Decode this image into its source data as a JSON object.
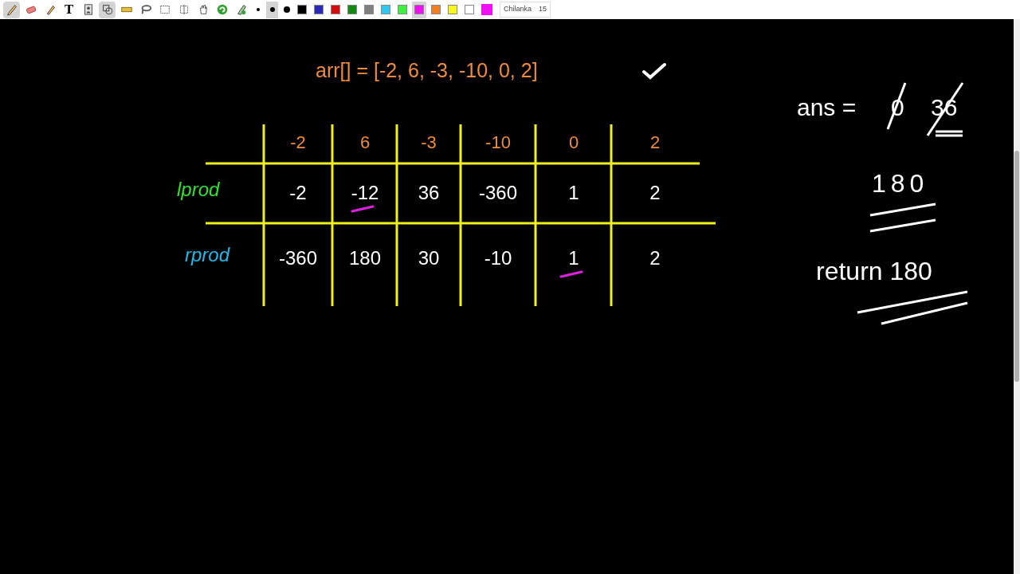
{
  "toolbar": {
    "tools": [
      {
        "kind": "pencil",
        "selected": true
      },
      {
        "kind": "eraser",
        "selected": false
      },
      {
        "kind": "highlighter",
        "selected": false
      },
      {
        "kind": "text",
        "label": "T",
        "selected": false
      },
      {
        "kind": "image",
        "selected": false
      },
      {
        "kind": "shapes",
        "selected": true
      },
      {
        "kind": "ruler",
        "selected": false
      },
      {
        "kind": "lasso",
        "selected": false
      },
      {
        "kind": "select",
        "selected": false
      },
      {
        "kind": "crop",
        "selected": false
      },
      {
        "kind": "hand",
        "selected": false
      },
      {
        "kind": "undo",
        "selected": false
      },
      {
        "kind": "clear",
        "selected": false
      }
    ],
    "sizes": [
      {
        "kind": "small",
        "selected": false
      },
      {
        "kind": "medium",
        "selected": true
      },
      {
        "kind": "large",
        "selected": false
      }
    ],
    "colors": [
      {
        "color": "#000000",
        "selected": false
      },
      {
        "color": "#2a2ab8",
        "selected": false
      },
      {
        "color": "#d01010",
        "selected": false
      },
      {
        "color": "#108a10",
        "selected": false
      },
      {
        "color": "#808080",
        "selected": false
      },
      {
        "color": "#2ec8f0",
        "selected": false
      },
      {
        "color": "#40f040",
        "selected": false
      },
      {
        "color": "#ee10ee",
        "selected": true
      },
      {
        "color": "#f08020",
        "selected": false
      },
      {
        "color": "#f8f820",
        "selected": false
      },
      {
        "color": "#ffffff",
        "selected": false
      }
    ],
    "current_color": {
      "color": "#ee10ee"
    },
    "font": {
      "family": "Chilanka",
      "size": "15"
    }
  },
  "board": {
    "array_line": "arr[] = [-2, 6, -3, -10, 0, 2]",
    "table": {
      "header": [
        "-2",
        "6",
        "-3",
        "-10",
        "0",
        "2"
      ],
      "rows": [
        {
          "label": "lprod",
          "color": "#30e030",
          "cells": [
            {
              "text": "-2",
              "underlined": false
            },
            {
              "text": "-12",
              "underlined": true
            },
            {
              "text": "36",
              "underlined": false
            },
            {
              "text": "-360",
              "underlined": false
            },
            {
              "text": "1",
              "underlined": false
            },
            {
              "text": "2",
              "underlined": false
            }
          ]
        },
        {
          "label": "rprod",
          "color": "#20b8e8",
          "cells": [
            {
              "text": "-360",
              "underlined": false
            },
            {
              "text": "180",
              "underlined": false
            },
            {
              "text": "30",
              "underlined": false
            },
            {
              "text": "-10",
              "underlined": false
            },
            {
              "text": "1",
              "underlined": true
            },
            {
              "text": "2",
              "underlined": false
            }
          ]
        }
      ]
    },
    "ans": {
      "label": "ans =",
      "values": [
        {
          "text": "0",
          "struck": true
        },
        {
          "text": "36",
          "struck": true
        }
      ]
    },
    "result": "180",
    "return_line": "return 180"
  }
}
